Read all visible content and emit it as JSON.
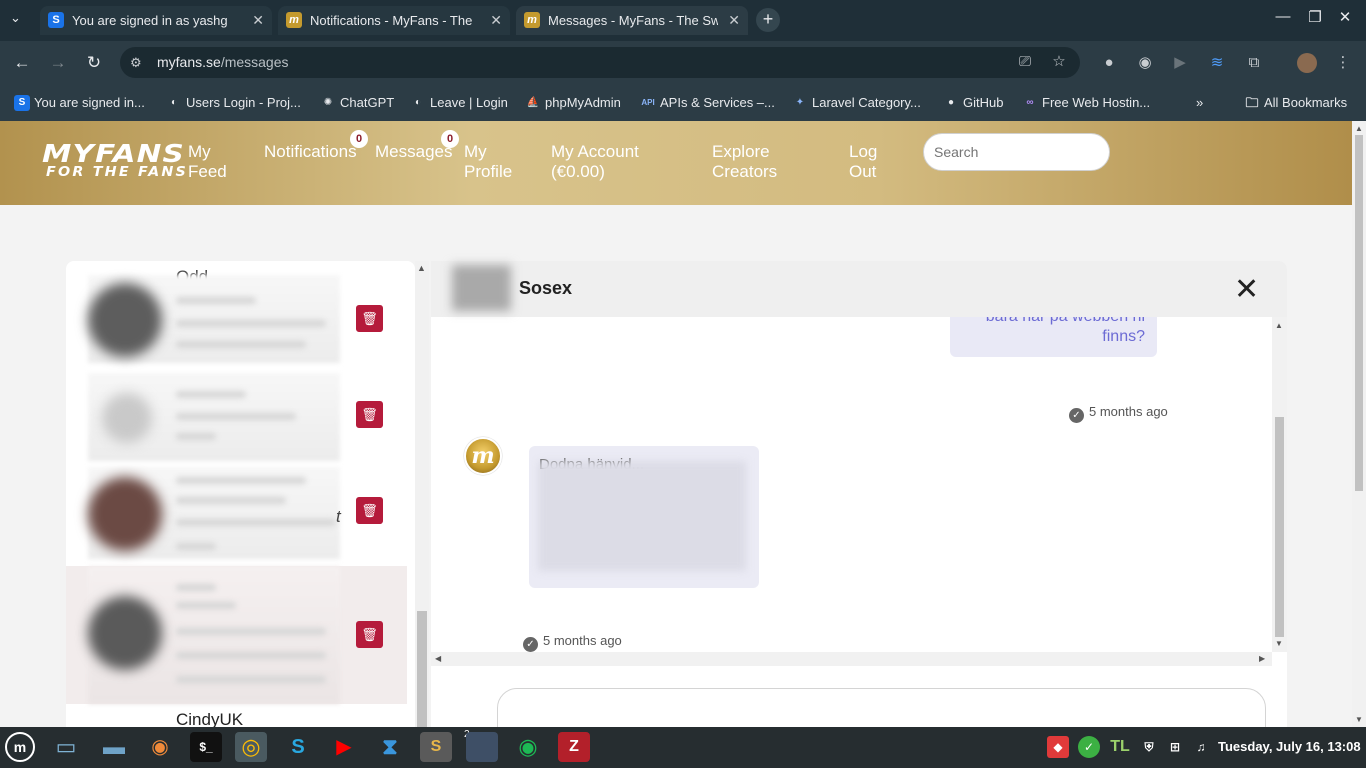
{
  "browser": {
    "tabs": [
      {
        "title": "You are signed in as yashg",
        "favicon_letter": "S",
        "favicon_color": "#1a73e8"
      },
      {
        "title": "Notifications - MyFans - The",
        "favicon_letter": "m",
        "favicon_color": "#c49a2e"
      },
      {
        "title": "Messages - MyFans - The Swe",
        "favicon_letter": "m",
        "favicon_color": "#c49a2e"
      }
    ],
    "new_tab_label": "+",
    "url_host": "myfans.se",
    "url_path": "/messages",
    "bookmarks": [
      {
        "label": "You are signed in...",
        "icon_letter": "S",
        "icon_color": "#1a73e8"
      },
      {
        "label": "Users Login - Proj...",
        "icon_letter": "◐",
        "icon_color": "#5f6368"
      },
      {
        "label": "ChatGPT",
        "icon_letter": "✺",
        "icon_color": "#202124"
      },
      {
        "label": "Leave | Login",
        "icon_letter": "◐",
        "icon_color": "#5f6368"
      },
      {
        "label": "phpMyAdmin",
        "icon_letter": "⛵",
        "icon_color": "#e6a23c"
      },
      {
        "label": "APIs & Services –...",
        "icon_letter": "API",
        "icon_color": "#4285f4"
      },
      {
        "label": "Laravel Category...",
        "icon_letter": "✦",
        "icon_color": "#3b6ea5"
      },
      {
        "label": "GitHub",
        "icon_letter": "●",
        "icon_color": "#24292e"
      },
      {
        "label": "Free Web Hostin...",
        "icon_letter": "∞",
        "icon_color": "#7b4bd6"
      }
    ],
    "bookmarks_overflow": "»",
    "all_bookmarks_label": "All Bookmarks"
  },
  "site": {
    "logo_line1": "MYFANS",
    "logo_line2": "FOR THE FANS",
    "nav": {
      "my_feed": "My Feed",
      "notifications": "Notifications",
      "notifications_count": "0",
      "messages": "Messages",
      "messages_count": "0",
      "my_profile": "My Profile",
      "my_account": "My Account (€0.00)",
      "explore_creators": "Explore Creators",
      "log_out": "Log Out"
    },
    "search_placeholder": "Search"
  },
  "conversations": {
    "top_partial_name": "Odd...",
    "italic_snippet_fragment": "t",
    "bottom_partial_name": "CindyUK"
  },
  "chat": {
    "contact_name": "Sosex",
    "outgoing_message_partial": "bara här på webben ni finns?",
    "outgoing_time": "5 months ago",
    "incoming_message_partial": "Dodpa hänvid...",
    "incoming_time": "5 months ago",
    "bot_avatar_letter": "m"
  },
  "taskbar": {
    "clock": "Tuesday, July 16, 13:08",
    "badge_count": "2"
  },
  "colors": {
    "delete_button": "#b51b3b",
    "header_gold": "#d3bb80",
    "outgoing_text": "#6c6bd4"
  }
}
